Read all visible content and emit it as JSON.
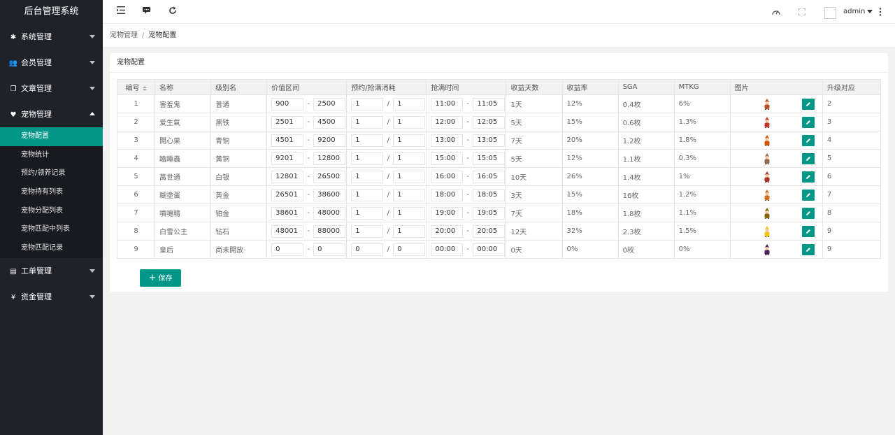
{
  "app_title": "后台管理系统",
  "sidebar": {
    "menus": [
      {
        "label": "系统管理",
        "icon": "gear-icon",
        "glyph": "✱",
        "expanded": false
      },
      {
        "label": "会员管理",
        "icon": "users-icon",
        "glyph": "👥",
        "expanded": false
      },
      {
        "label": "文章管理",
        "icon": "copy-icon",
        "glyph": "❐",
        "expanded": false
      },
      {
        "label": "宠物管理",
        "icon": "heart-icon",
        "glyph": "♥",
        "expanded": true
      },
      {
        "label": "工单管理",
        "icon": "file-icon",
        "glyph": "▤",
        "expanded": false
      },
      {
        "label": "资金管理",
        "icon": "yen-icon",
        "glyph": "¥",
        "expanded": false
      }
    ],
    "pet_submenu": [
      "宠物配置",
      "宠物统计",
      "预约/领养记录",
      "宠物持有列表",
      "宠物分配列表",
      "宠物匹配中列表",
      "宠物匹配记录"
    ],
    "active_sub": "宠物配置"
  },
  "header": {
    "user": "admin"
  },
  "breadcrumb": {
    "parent": "宠物管理",
    "sep": "/",
    "current": "宠物配置"
  },
  "card_title": "宠物配置",
  "table": {
    "headers": [
      "编号",
      "名称",
      "级别名",
      "价值区间",
      "预约/抢满消耗",
      "抢满时间",
      "收益天数",
      "收益率",
      "SGA",
      "MTKG",
      "图片",
      "升级对应"
    ],
    "rows": [
      {
        "id": "1",
        "name": "害羞鬼",
        "level": "普通",
        "min": "900",
        "max": "2500",
        "c1": "1",
        "c2": "1",
        "t1": "11:00",
        "t2": "11:05",
        "days": "1天",
        "rate": "12%",
        "sga": "0.4枚",
        "mtkg": "6%",
        "up": "2",
        "color": "#b5522b"
      },
      {
        "id": "2",
        "name": "爱生氣",
        "level": "黑铁",
        "min": "2501",
        "max": "4500",
        "c1": "1",
        "c2": "1",
        "t1": "12:00",
        "t2": "12:05",
        "days": "5天",
        "rate": "15%",
        "sga": "0.6枚",
        "mtkg": "1.3%",
        "up": "3",
        "color": "#c0392b"
      },
      {
        "id": "3",
        "name": "開心果",
        "level": "青铜",
        "min": "4501",
        "max": "9200",
        "c1": "1",
        "c2": "1",
        "t1": "13:00",
        "t2": "13:05",
        "days": "7天",
        "rate": "20%",
        "sga": "1.2枚",
        "mtkg": "1.8%",
        "up": "4",
        "color": "#d35400"
      },
      {
        "id": "4",
        "name": "瞌睡蟲",
        "level": "黄铜",
        "min": "9201",
        "max": "12800",
        "c1": "1",
        "c2": "1",
        "t1": "15:00",
        "t2": "15:05",
        "days": "5天",
        "rate": "12%",
        "sga": "1.1枚",
        "mtkg": "0.3%",
        "up": "5",
        "color": "#8e6b4f"
      },
      {
        "id": "5",
        "name": "萬世通",
        "level": "白银",
        "min": "12801",
        "max": "26500",
        "c1": "1",
        "c2": "1",
        "t1": "16:00",
        "t2": "16:05",
        "days": "10天",
        "rate": "26%",
        "sga": "1.4枚",
        "mtkg": "1%",
        "up": "6",
        "color": "#a93226"
      },
      {
        "id": "6",
        "name": "糊塗蛋",
        "level": "黄金",
        "min": "26501",
        "max": "38600",
        "c1": "1",
        "c2": "1",
        "t1": "18:00",
        "t2": "18:05",
        "days": "3天",
        "rate": "15%",
        "sga": "16枚",
        "mtkg": "1.2%",
        "up": "7",
        "color": "#ca6f1e"
      },
      {
        "id": "7",
        "name": "噴嚏精",
        "level": "铂金",
        "min": "38601",
        "max": "48000",
        "c1": "1",
        "c2": "1",
        "t1": "19:00",
        "t2": "19:05",
        "days": "7天",
        "rate": "18%",
        "sga": "1.8枚",
        "mtkg": "1.1%",
        "up": "8",
        "color": "#7d6608"
      },
      {
        "id": "8",
        "name": "白雪公主",
        "level": "钻石",
        "min": "48001",
        "max": "88000",
        "c1": "1",
        "c2": "1",
        "t1": "20:00",
        "t2": "20:05",
        "days": "12天",
        "rate": "32%",
        "sga": "2.3枚",
        "mtkg": "1.5%",
        "up": "9",
        "color": "#f1c40f"
      },
      {
        "id": "9",
        "name": "皇后",
        "level": "尚未開放",
        "min": "0",
        "max": "0",
        "c1": "0",
        "c2": "0",
        "t1": "00:00",
        "t2": "00:00",
        "days": "0天",
        "rate": "0%",
        "sga": "0枚",
        "mtkg": "0%",
        "up": "9",
        "color": "#4a235a"
      }
    ]
  },
  "save_label": "保存",
  "colors": {
    "accent": "#009688",
    "sidebar": "#20222a"
  }
}
